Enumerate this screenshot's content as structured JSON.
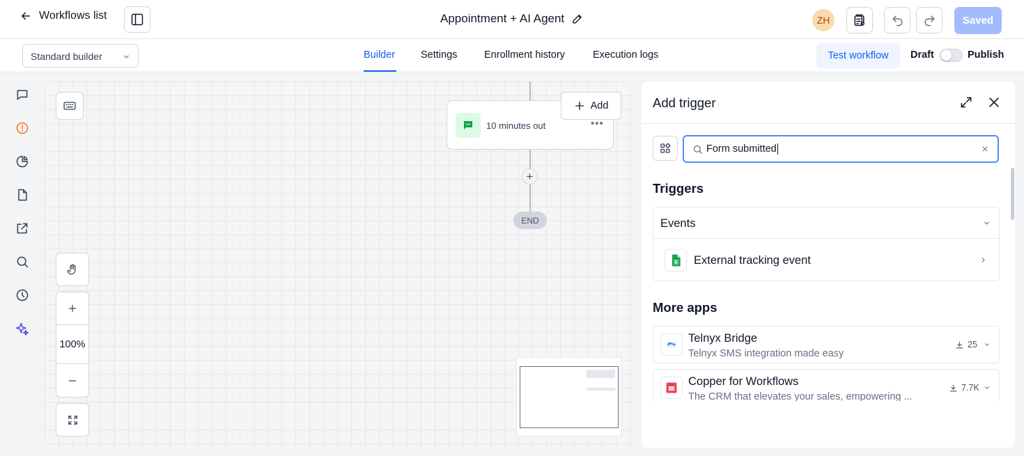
{
  "header": {
    "back_label": "Workflows list",
    "workflow_title": "Appointment + AI Agent",
    "avatar_initials": "ZH",
    "saved_label": "Saved"
  },
  "subbar": {
    "builder_select": "Standard builder",
    "tabs": [
      {
        "label": "Builder",
        "active": true
      },
      {
        "label": "Settings",
        "active": false
      },
      {
        "label": "Enrollment history",
        "active": false
      },
      {
        "label": "Execution logs",
        "active": false
      }
    ],
    "test_workflow_label": "Test workflow",
    "draft_label": "Draft",
    "publish_label": "Publish",
    "published": false
  },
  "sidebar": {
    "icons": [
      "chat-icon",
      "alert-circle-icon",
      "pie-chart-icon",
      "document-icon",
      "external-link-icon",
      "search-icon",
      "history-icon",
      "sparkle-icon"
    ]
  },
  "canvas": {
    "node_label": "10 minutes out",
    "add_label": "Add",
    "end_label": "END",
    "zoom_level": "100%"
  },
  "panel": {
    "title": "Add trigger",
    "search_value": "Form submitted",
    "triggers_heading": "Triggers",
    "events_label": "Events",
    "event_items": [
      {
        "label": "External tracking event"
      }
    ],
    "more_apps_heading": "More apps",
    "apps": [
      {
        "name": "Telnyx Bridge",
        "description": "Telnyx SMS integration made easy",
        "installs": "25"
      },
      {
        "name": "Copper for Workflows",
        "description": "The CRM that elevates your sales, empowering ...",
        "installs": "7.7K"
      }
    ]
  },
  "colors": {
    "accent": "#155eef",
    "saved_button": "#a4bcfd",
    "avatar_bg": "#f9dbaf",
    "sms_node_bg": "#dcfae6"
  }
}
